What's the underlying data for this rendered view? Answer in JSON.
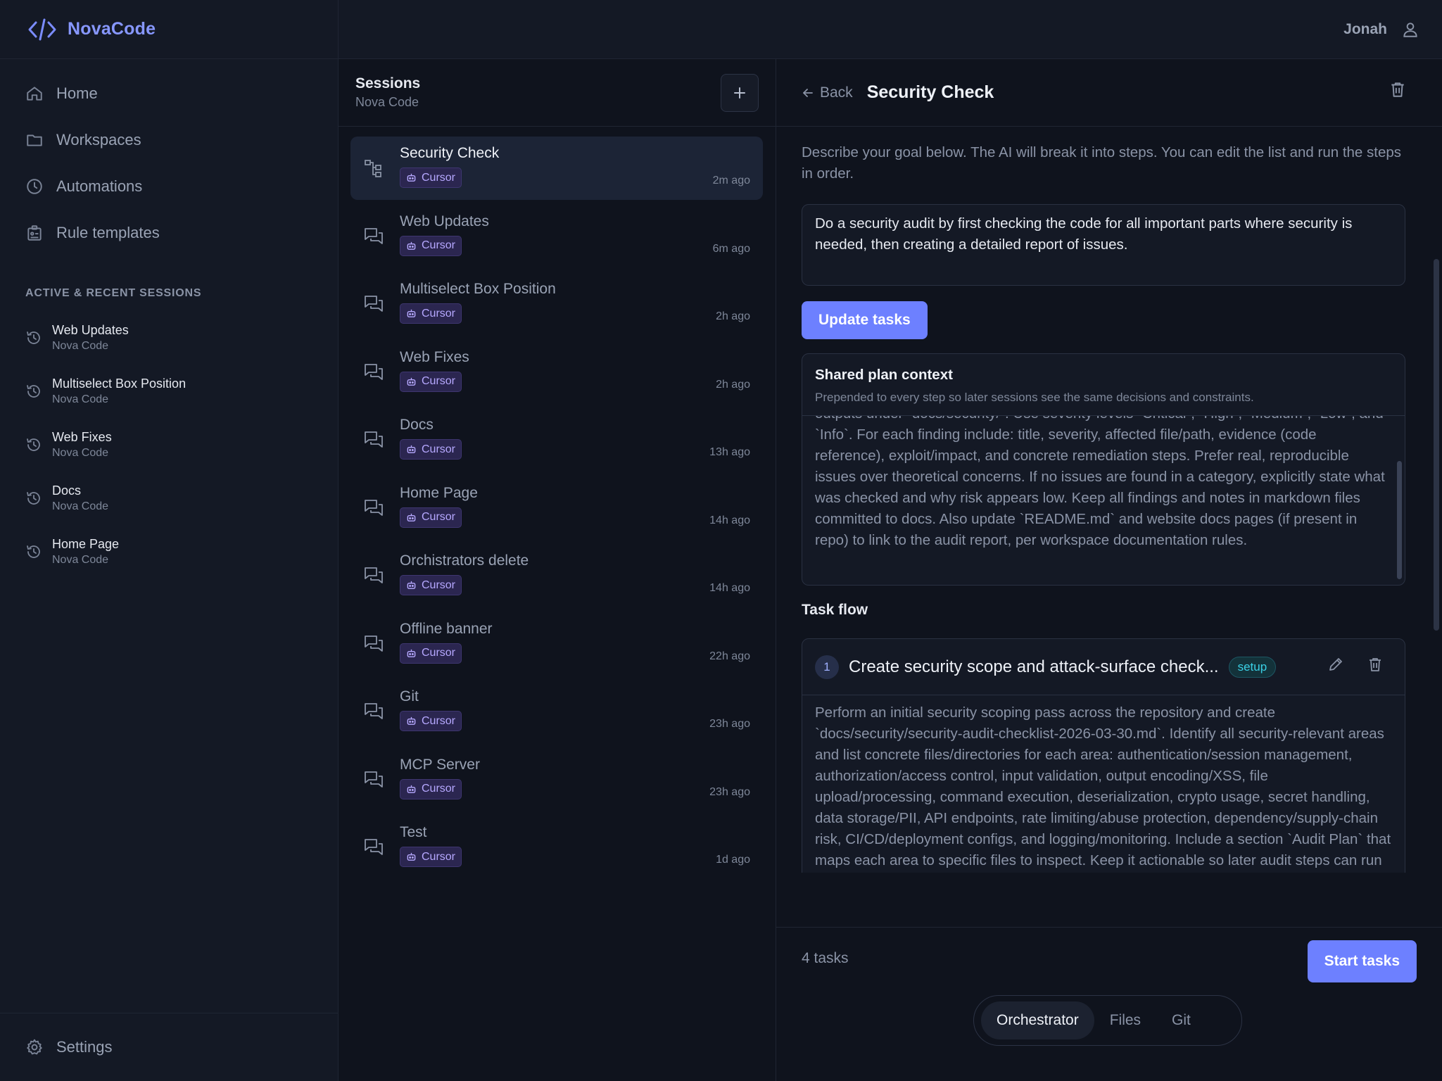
{
  "brand": {
    "name": "NovaCode",
    "icon": "code-brackets-icon"
  },
  "nav": [
    {
      "label": "Home",
      "icon": "home-icon"
    },
    {
      "label": "Workspaces",
      "icon": "folder-icon"
    },
    {
      "label": "Automations",
      "icon": "clock-icon"
    },
    {
      "label": "Rule templates",
      "icon": "clipboard-icon"
    }
  ],
  "recent_label": "ACTIVE & RECENT SESSIONS",
  "recent": [
    {
      "title": "Web Updates",
      "sub": "Nova Code"
    },
    {
      "title": "Multiselect Box Position",
      "sub": "Nova Code"
    },
    {
      "title": "Web Fixes",
      "sub": "Nova Code"
    },
    {
      "title": "Docs",
      "sub": "Nova Code"
    },
    {
      "title": "Home Page",
      "sub": "Nova Code"
    }
  ],
  "settings_label": "Settings",
  "user": {
    "name": "Jonah"
  },
  "sessions": {
    "title": "Sessions",
    "subtitle": "Nova Code",
    "items": [
      {
        "title": "Security Check",
        "badge": "Cursor",
        "time": "2m ago",
        "active": true
      },
      {
        "title": "Web Updates",
        "badge": "Cursor",
        "time": "6m ago"
      },
      {
        "title": "Multiselect Box Position",
        "badge": "Cursor",
        "time": "2h ago"
      },
      {
        "title": "Web Fixes",
        "badge": "Cursor",
        "time": "2h ago"
      },
      {
        "title": "Docs",
        "badge": "Cursor",
        "time": "13h ago"
      },
      {
        "title": "Home Page",
        "badge": "Cursor",
        "time": "14h ago"
      },
      {
        "title": "Orchistrators delete",
        "badge": "Cursor",
        "time": "14h ago"
      },
      {
        "title": "Offline banner",
        "badge": "Cursor",
        "time": "22h ago"
      },
      {
        "title": "Git",
        "badge": "Cursor",
        "time": "23h ago"
      },
      {
        "title": "MCP Server",
        "badge": "Cursor",
        "time": "23h ago"
      },
      {
        "title": "Test",
        "badge": "Cursor",
        "time": "1d ago"
      }
    ]
  },
  "detail": {
    "back_label": "Back",
    "title": "Security Check",
    "intro": "Describe your goal below. The AI will break it into steps. You can edit the list and run the steps in order.",
    "goal": "Do a security audit by first checking the code for all important parts where security is needed, then creating a detailed report of issues.",
    "update_label": "Update tasks",
    "shared_title": "Shared plan context",
    "shared_sub": "Prepended to every step so later sessions see the same decisions and constraints.",
    "shared_text": "outputs under `docs/security/`. Use severity levels `Critical`, `High`, `Medium`, `Low`, and `Info`. For each finding include: title, severity, affected file/path, evidence (code reference), exploit/impact, and concrete remediation steps. Prefer real, reproducible issues over theoretical concerns. If no issues are found in a category, explicitly state what was checked and why risk appears low. Keep all findings and notes in markdown files committed to docs. Also update `README.md` and website docs pages (if present in repo) to link to the audit report, per workspace documentation rules.",
    "flow_label": "Task flow",
    "task": {
      "number": "1",
      "title": "Create security scope and attack-surface check...",
      "tag": "setup",
      "text": "Perform an initial security scoping pass across the repository and create `docs/security/security-audit-checklist-2026-03-30.md`. Identify all security-relevant areas and list concrete files/directories for each area: authentication/session management, authorization/access control, input validation, output encoding/XSS, file upload/processing, command execution, deserialization, crypto usage, secret handling, data storage/PII, API endpoints, rate limiting/abuse protection, dependency/supply-chain risk, CI/CD/deployment configs, and logging/monitoring. Include a section `Audit Plan` that maps each area to specific files to inspect. Keep it actionable so later audit steps can run independently."
    },
    "task_count": "4 tasks",
    "start_label": "Start tasks",
    "tabs": [
      {
        "label": "Orchestrator",
        "active": true
      },
      {
        "label": "Files"
      },
      {
        "label": "Git"
      }
    ]
  }
}
